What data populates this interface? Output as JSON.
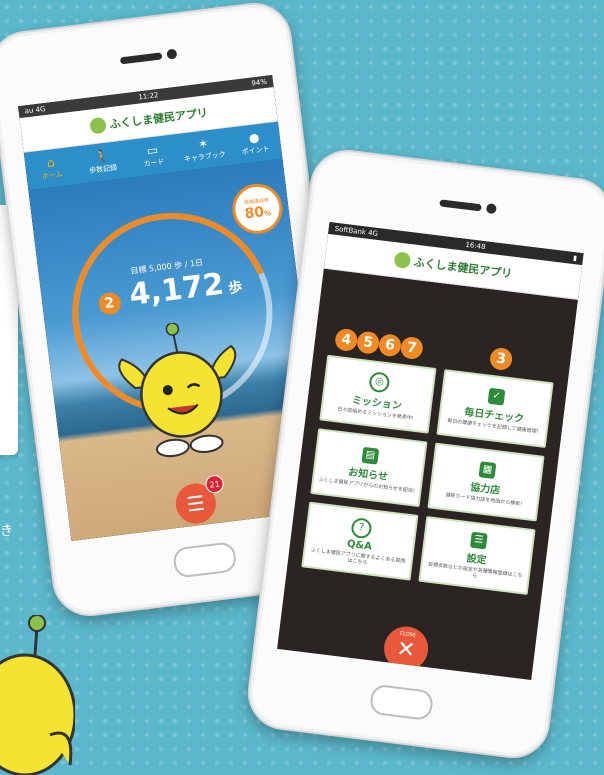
{
  "colors": {
    "background": "#5bb8cc",
    "accent_orange": "#f08a24",
    "menu_red": "#e8593b",
    "tab_blue": "#2d8fc9",
    "card_green": "#2e8b3a"
  },
  "phone1": {
    "status": {
      "carrier": "au 4G",
      "time": "11:22",
      "battery": "94%"
    },
    "app_title": "ふくしま健民アプリ",
    "tabs": [
      {
        "label": "ホーム",
        "icon": "home-icon",
        "glyph": "⌂"
      },
      {
        "label": "歩数記録",
        "icon": "walk-icon",
        "glyph": "🚶"
      },
      {
        "label": "カード",
        "icon": "card-icon",
        "glyph": "▭"
      },
      {
        "label": "キャラブック",
        "icon": "character-icon",
        "glyph": "✶"
      },
      {
        "label": "ポイント",
        "icon": "points-icon",
        "glyph": "●"
      }
    ],
    "goal_text": "目標 5,000 歩 / 1日",
    "steps": "4,172",
    "steps_unit": "歩",
    "achievement_label": "目標達成率",
    "achievement_pct": "80",
    "achievement_pct_unit": "%",
    "badge_number": "2",
    "menu_label": "MENU",
    "menu_count": "21"
  },
  "phone2": {
    "status": {
      "carrier": "SoftBank 4G",
      "time": "16:48"
    },
    "app_title": "ふくしま健民アプリ",
    "badges": [
      "4",
      "5",
      "6",
      "7",
      "3"
    ],
    "cards": [
      {
        "title": "ミッション",
        "desc": "日々取組めるミッションを発表中!",
        "icon": "mission-icon",
        "glyph": "◎"
      },
      {
        "title": "毎日チェック",
        "desc": "毎日の健康チェックを記録して健康管理!",
        "icon": "daily-check-icon",
        "glyph": "✓"
      },
      {
        "title": "お知らせ",
        "desc": "ふくしま健民アプリからのお知らせを配信!",
        "icon": "news-icon",
        "glyph": "▤"
      },
      {
        "title": "協力店",
        "desc": "健民カード協力店を地図から検索!",
        "icon": "store-icon",
        "glyph": "▦"
      },
      {
        "title": "Q&A",
        "desc": "ふくしま健民アプリに関するよくある質問はこちら",
        "icon": "help-icon",
        "glyph": "?"
      },
      {
        "title": "設定",
        "desc": "目標歩数などの設定や各種情報登録はこちら",
        "icon": "settings-icon",
        "glyph": "☰"
      }
    ],
    "close_label": "CLOSE",
    "close_glyph": "✕"
  },
  "side": {
    "edge_text": "き"
  }
}
